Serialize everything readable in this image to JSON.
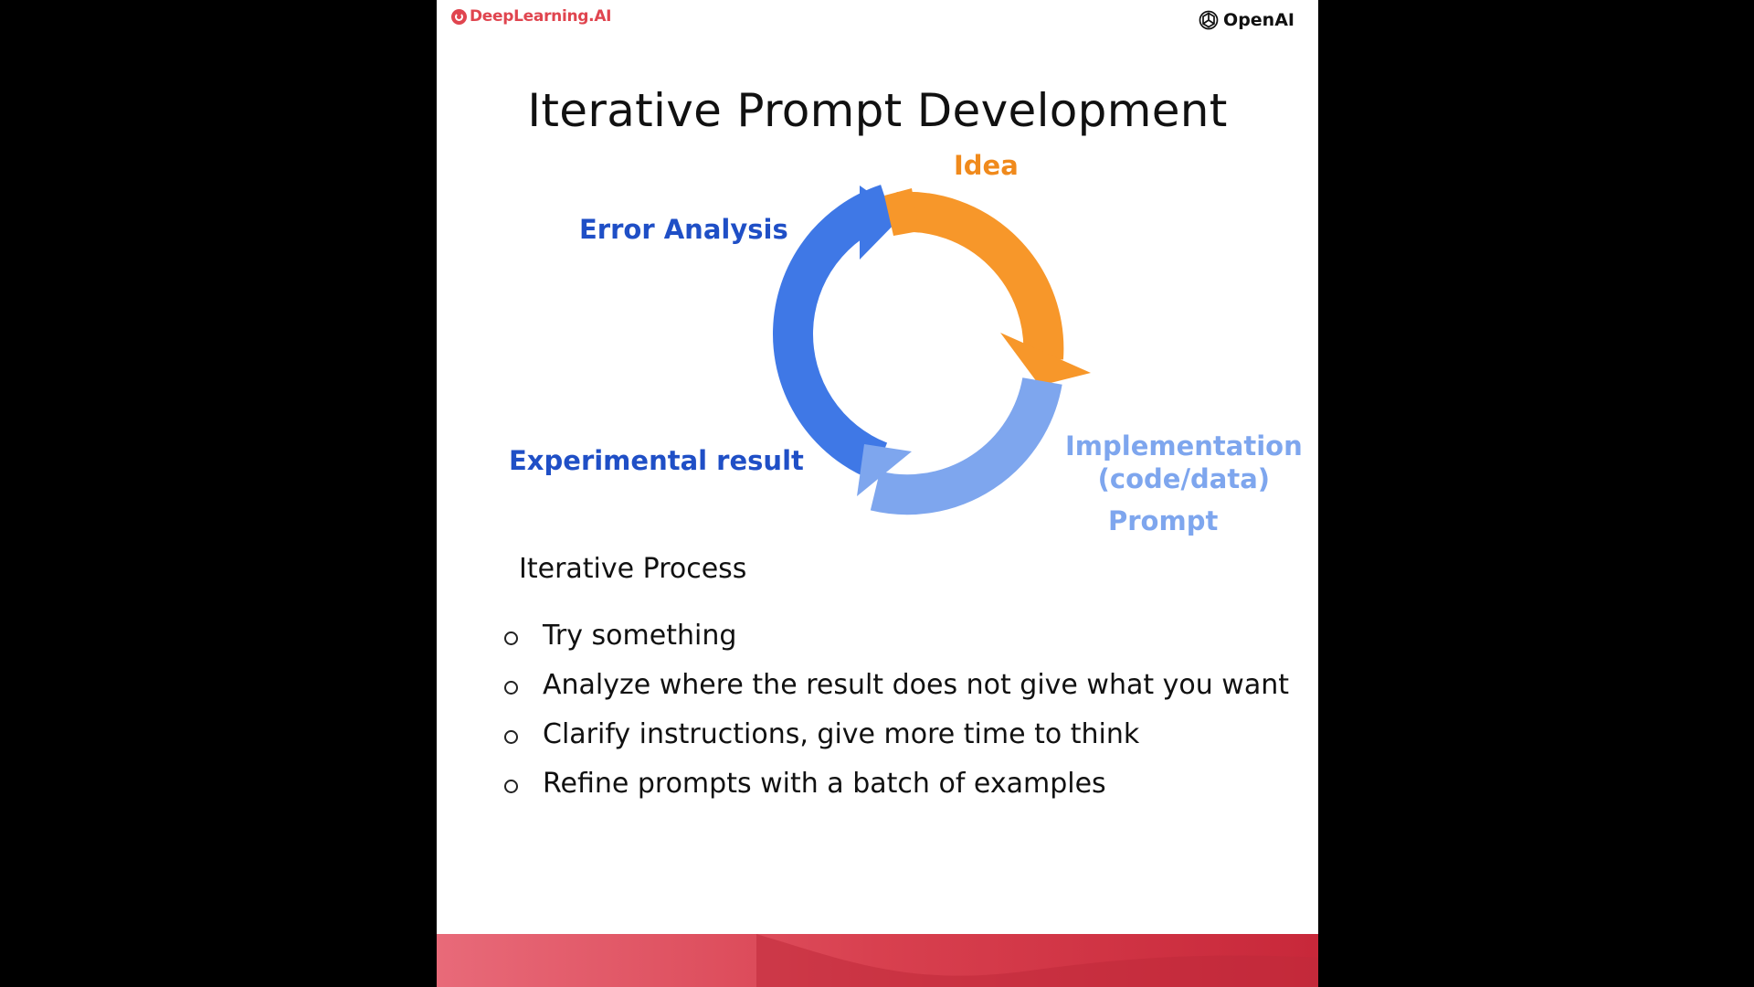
{
  "brand": {
    "left_logo_text": "DeepLearning.AI",
    "right_logo_text": "OpenAI"
  },
  "slide": {
    "title": "Iterative Prompt Development"
  },
  "diagram": {
    "labels": {
      "idea": "Idea",
      "implementation_line1": "Implementation",
      "implementation_line2": "(code/data)",
      "prompt": "Prompt",
      "experimental_result": "Experimental result",
      "error_analysis": "Error Analysis"
    },
    "colors": {
      "idea": "#f7972a",
      "implementation": "#7ea6ee",
      "error": "#3f78e6",
      "label_dark_blue": "#1f4fc6",
      "label_orange": "#f08a1c"
    }
  },
  "process": {
    "title": "Iterative Process",
    "items": [
      "Try something",
      "Analyze where the result does not give what you want",
      "Clarify instructions, give more time to think",
      "Refine prompts with a batch of examples"
    ]
  },
  "theme": {
    "background": "#000000",
    "slide_background": "#ffffff",
    "footer_red": "#d8404f"
  }
}
